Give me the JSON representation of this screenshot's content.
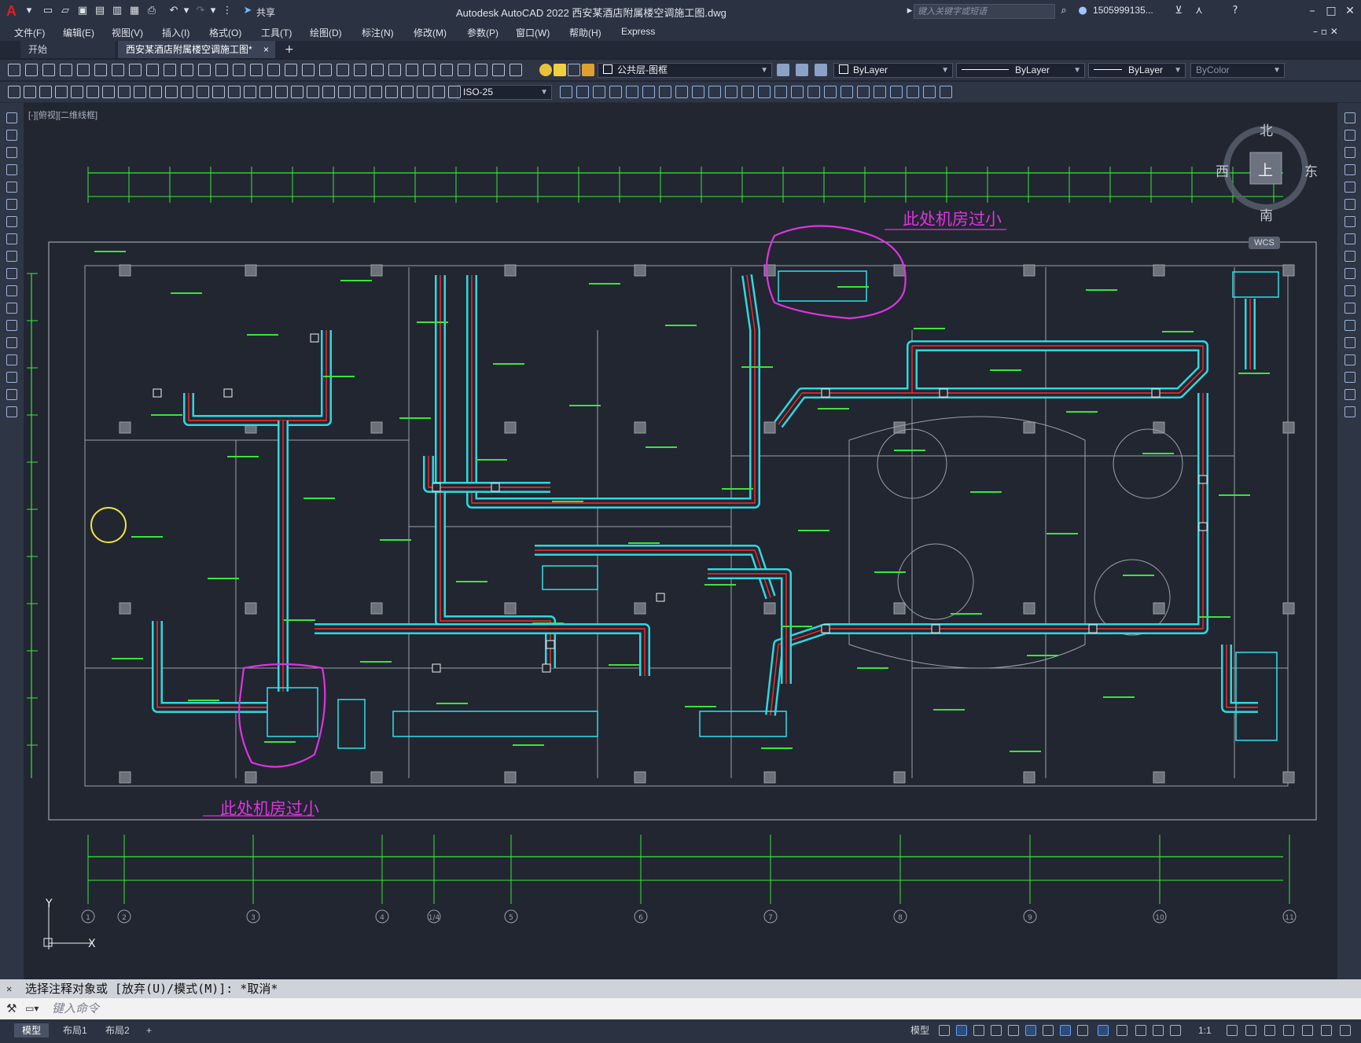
{
  "app": {
    "logo": "A",
    "title": "Autodesk AutoCAD 2022    西安某酒店附属楼空调施工图.dwg",
    "search_placeholder": "键入关键字或短语",
    "user": "1505999135...",
    "share_label": "共享"
  },
  "menu": [
    "文件(F)",
    "编辑(E)",
    "视图(V)",
    "插入(I)",
    "格式(O)",
    "工具(T)",
    "绘图(D)",
    "标注(N)",
    "修改(M)",
    "参数(P)",
    "窗口(W)",
    "帮助(H)",
    "Express"
  ],
  "tabs": {
    "start": "开始",
    "drawing": "西安某酒店附属楼空调施工图*",
    "close": "×",
    "add": "+"
  },
  "toolbar": {
    "layer": "公共层-图框",
    "color": "ByLayer",
    "linetype": "ByLayer",
    "lineweight": "ByLayer",
    "plotstyle": "ByColor",
    "dimstyle": "ISO-25"
  },
  "viewport": {
    "label": "[-][俯视][二维线框]"
  },
  "viewcube": {
    "north": "北",
    "south": "南",
    "east": "东",
    "west": "西",
    "top": "上",
    "wcs": "WCS"
  },
  "annotations": {
    "top_note": "此处机房过小",
    "bottom_note": "此处机房过小"
  },
  "axis": {
    "y": "Y",
    "x": "X",
    "grid_labels": [
      "1",
      "2",
      "3",
      "4",
      "1/4",
      "5",
      "6",
      "7",
      "8",
      "9",
      "10",
      "11"
    ]
  },
  "command": {
    "history": "选择注释对象或 [放弃(U)/模式(M)]: *取消*",
    "placeholder": "键入命令"
  },
  "status": {
    "model_tab": "模型",
    "layout1": "布局1",
    "layout2": "布局2",
    "add": "+",
    "model_label": "模型",
    "scale": "1:1"
  },
  "colors": {
    "green": "#39e639",
    "cyan": "#31e0e8",
    "red": "#ff2a2a",
    "magenta": "#e033e0",
    "gray": "#9aa0a8",
    "white": "#f0f0f0",
    "yellow": "#f0e040"
  }
}
